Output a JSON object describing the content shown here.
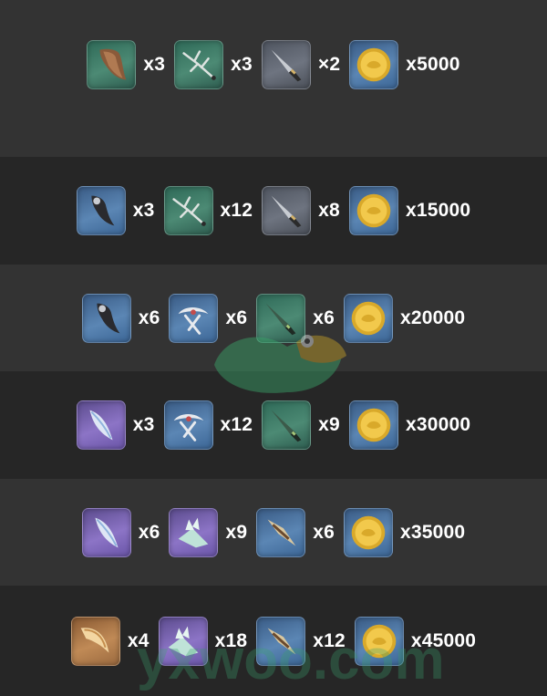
{
  "colors": {
    "row_light": "#333333",
    "row_dark": "#262626",
    "text": "#ffffff",
    "rarity_green": "#4c8a74",
    "rarity_gray": "#6e7480",
    "rarity_blue": "#5b86b4",
    "rarity_purple": "#8c74c6",
    "rarity_orange": "#c08a56"
  },
  "rows": [
    {
      "items": [
        {
          "icon": "brown-claw-icon",
          "rarity": "green",
          "qty": "x3"
        },
        {
          "icon": "branch-antler-icon",
          "rarity": "green",
          "qty": "x3"
        },
        {
          "icon": "blade-fragment-icon",
          "rarity": "gray",
          "qty": "×2"
        },
        {
          "icon": "gold-coin-icon",
          "rarity": "blue",
          "qty": "x5000"
        }
      ]
    },
    {
      "items": [
        {
          "icon": "dark-claw-icon",
          "rarity": "blue",
          "qty": "x3"
        },
        {
          "icon": "branch-antler-icon",
          "rarity": "green",
          "qty": "x12"
        },
        {
          "icon": "blade-fragment-icon",
          "rarity": "gray",
          "qty": "x8"
        },
        {
          "icon": "gold-coin-icon",
          "rarity": "blue",
          "qty": "x15000"
        }
      ]
    },
    {
      "items": [
        {
          "icon": "dark-claw-icon",
          "rarity": "blue",
          "qty": "x6"
        },
        {
          "icon": "white-horn-icon",
          "rarity": "blue",
          "qty": "x6"
        },
        {
          "icon": "green-blade-icon",
          "rarity": "green",
          "qty": "x6"
        },
        {
          "icon": "gold-coin-icon",
          "rarity": "blue",
          "qty": "x20000"
        }
      ]
    },
    {
      "items": [
        {
          "icon": "ice-feather-icon",
          "rarity": "purple",
          "qty": "x3"
        },
        {
          "icon": "white-horn-icon",
          "rarity": "blue",
          "qty": "x12"
        },
        {
          "icon": "green-blade-icon",
          "rarity": "green",
          "qty": "x9"
        },
        {
          "icon": "gold-coin-icon",
          "rarity": "blue",
          "qty": "x30000"
        }
      ]
    },
    {
      "items": [
        {
          "icon": "ice-feather-icon",
          "rarity": "purple",
          "qty": "x6"
        },
        {
          "icon": "crystal-wing-icon",
          "rarity": "purple",
          "qty": "x9"
        },
        {
          "icon": "bone-spear-icon",
          "rarity": "blue",
          "qty": "x6"
        },
        {
          "icon": "gold-coin-icon",
          "rarity": "blue",
          "qty": "x35000"
        }
      ]
    },
    {
      "items": [
        {
          "icon": "golden-horn-icon",
          "rarity": "orange",
          "qty": "x4"
        },
        {
          "icon": "crystal-wing-icon",
          "rarity": "purple",
          "qty": "x18"
        },
        {
          "icon": "bone-spear-icon",
          "rarity": "blue",
          "qty": "x12"
        },
        {
          "icon": "gold-coin-icon",
          "rarity": "blue",
          "qty": "x45000"
        }
      ]
    }
  ],
  "watermark": {
    "text": "yxwoo.com",
    "icon": "duck-logo-icon"
  }
}
